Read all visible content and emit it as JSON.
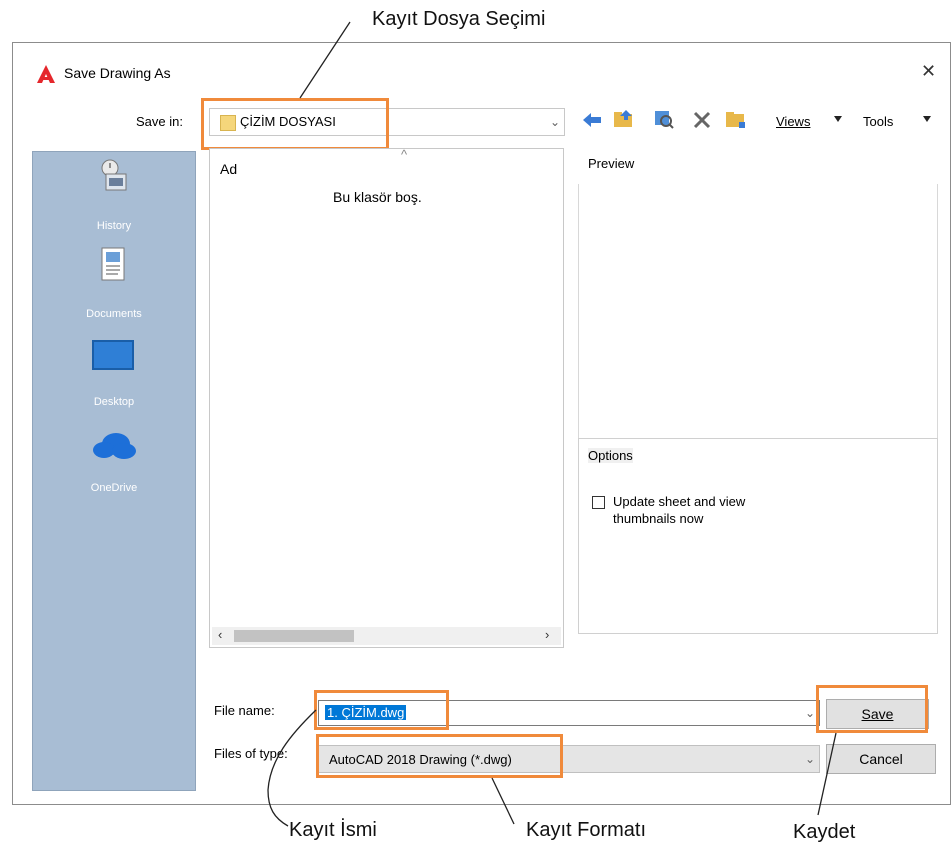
{
  "annotations": {
    "save_location": "Kayıt Dosya Seçimi",
    "file_name": "Kayıt İsmi",
    "file_format": "Kayıt Formatı",
    "save": "Kaydet"
  },
  "window": {
    "title": "Save Drawing As",
    "close_glyph": "✕",
    "app_icon": "autocad-logo-icon"
  },
  "toolbar": {
    "save_in_label": "Save in:",
    "save_in_value": "ÇİZİM DOSYASI",
    "views_label": "Views",
    "tools_label": "Tools",
    "icons": [
      "back-icon",
      "up-folder-icon",
      "search-web-icon",
      "delete-icon",
      "new-folder-icon"
    ]
  },
  "places": [
    {
      "label": "History",
      "icon": "history-icon"
    },
    {
      "label": "Documents",
      "icon": "documents-icon"
    },
    {
      "label": "Desktop",
      "icon": "desktop-icon"
    },
    {
      "label": "OneDrive",
      "icon": "onedrive-icon"
    }
  ],
  "file_list": {
    "column_header": "Ad",
    "empty_message": "Bu klasör boş."
  },
  "preview": {
    "label": "Preview"
  },
  "options": {
    "label": "Options",
    "checkbox_label_line1": "Update sheet and view",
    "checkbox_label_line2": "thumbnails now",
    "checked": false
  },
  "bottom": {
    "file_name_label": "File name:",
    "file_name_value": "1. ÇİZİM.dwg",
    "files_of_type_label": "Files of type:",
    "files_of_type_value": "AutoCAD 2018 Drawing (*.dwg)",
    "save_button": "Save",
    "cancel_button": "Cancel"
  },
  "colors": {
    "highlight": "#f08a3b",
    "places_bg": "#a8bdd4",
    "selection": "#0078d7"
  }
}
